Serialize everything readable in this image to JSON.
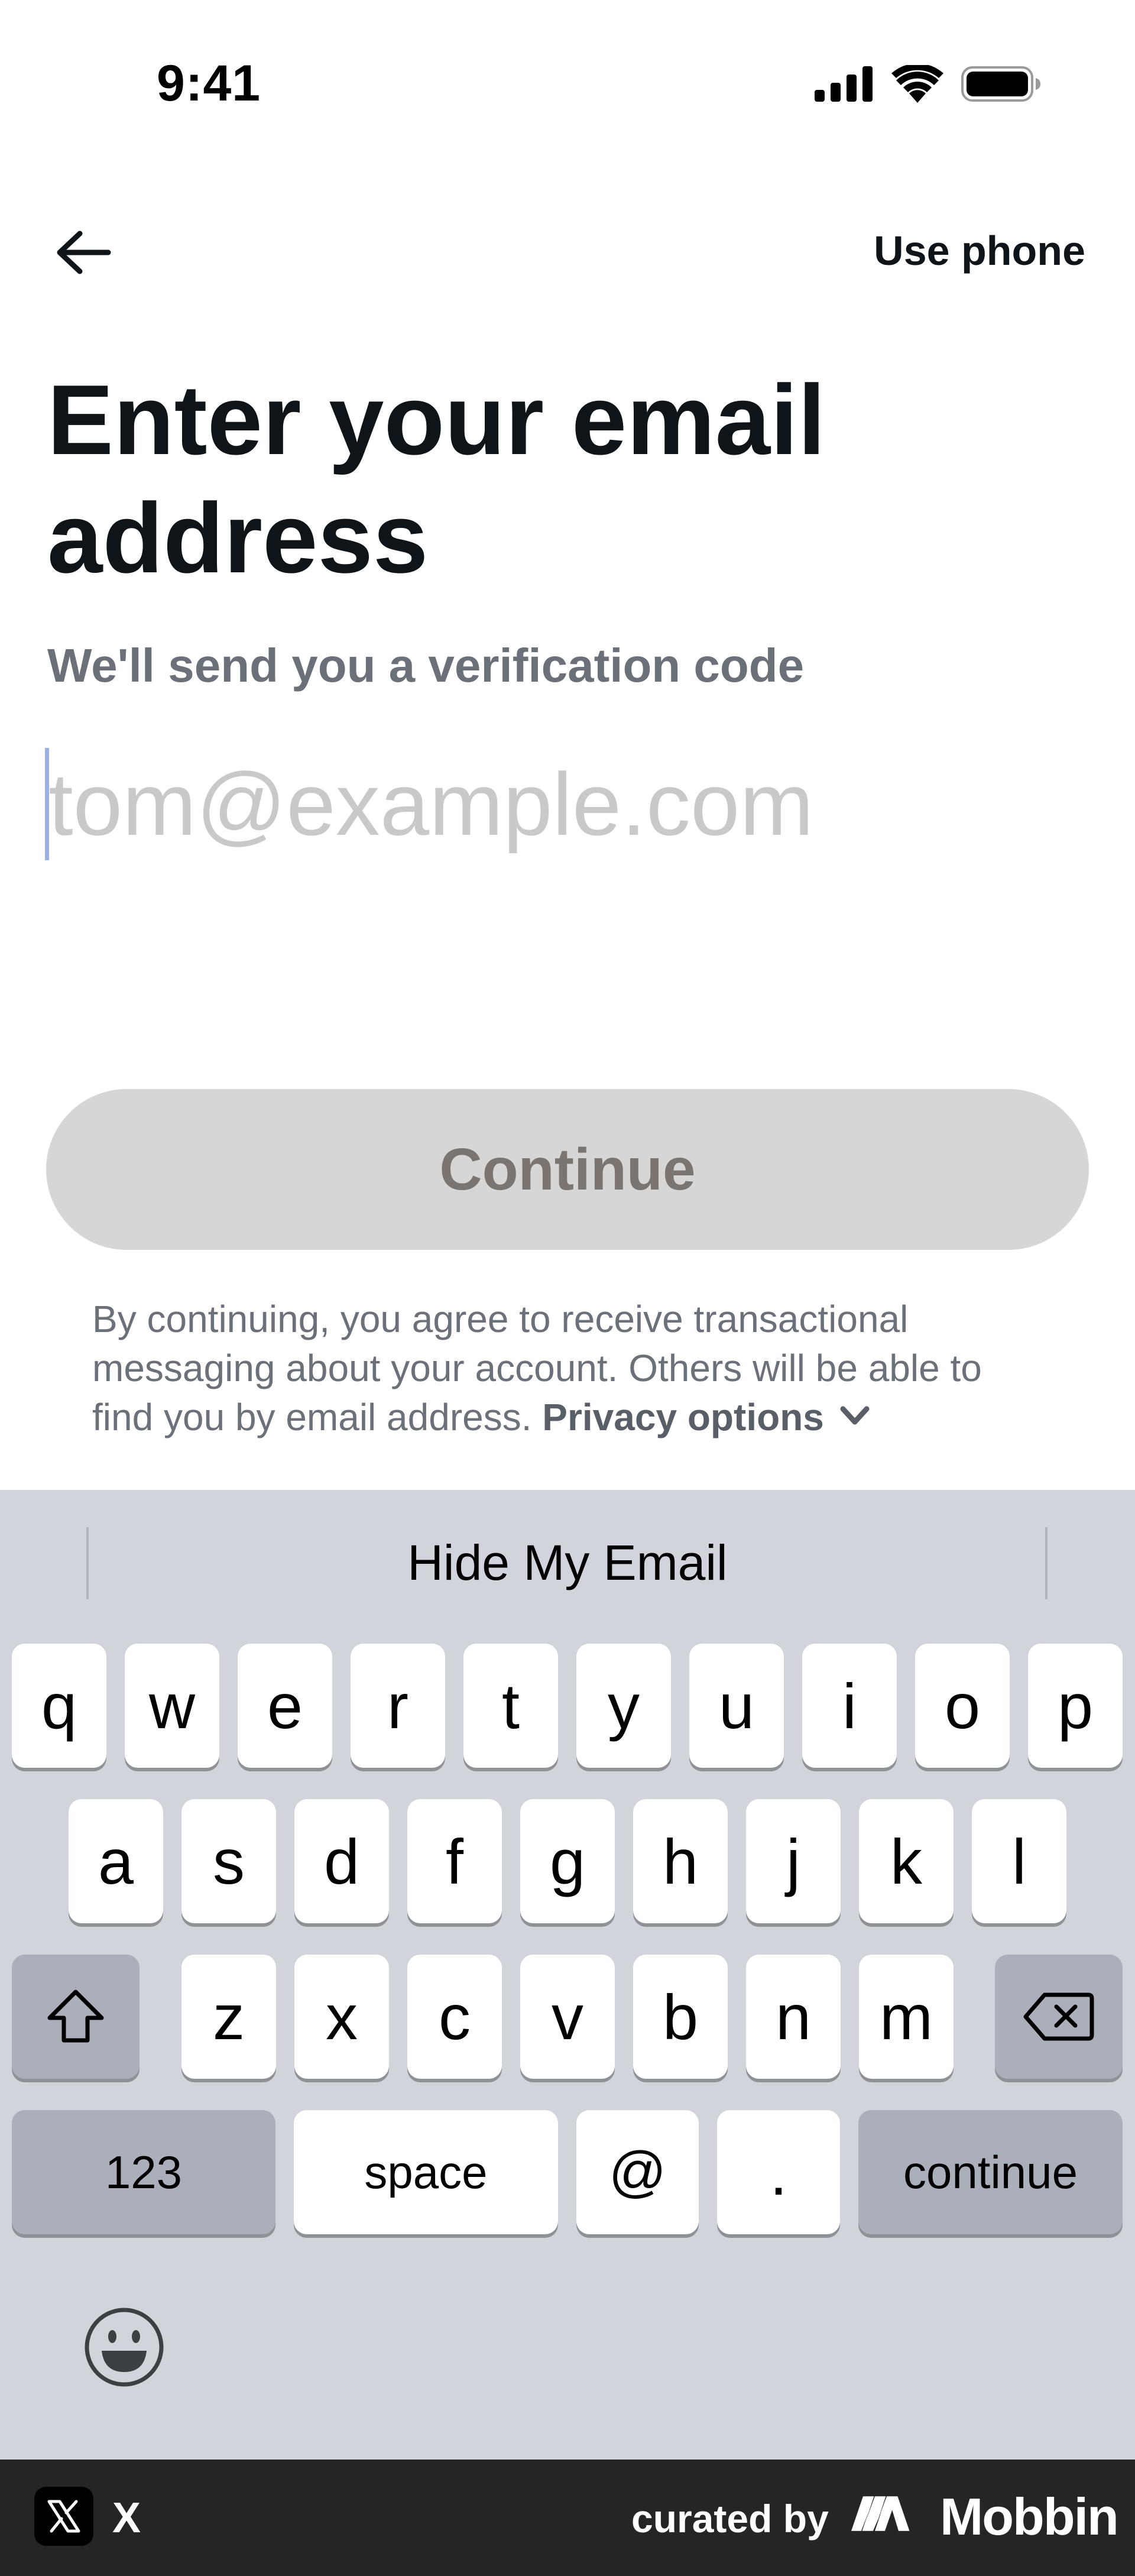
{
  "status_bar": {
    "time": "9:41",
    "signal_icon": "cellular-signal-icon",
    "wifi_icon": "wifi-icon",
    "battery_icon": "battery-icon"
  },
  "header": {
    "back_icon": "arrow-left-icon",
    "use_phone_label": "Use phone"
  },
  "main": {
    "title": "Enter your email address",
    "subtitle": "We'll send you a verification code",
    "email_placeholder": "tom@example.com",
    "email_value": "",
    "continue_label": "Continue",
    "disclaimer_text": "By continuing, you agree to receive transactional messaging about your account. Others will be able to find you by email address. ",
    "privacy_options_label": "Privacy options",
    "privacy_chevron_icon": "chevron-down-icon"
  },
  "keyboard": {
    "suggestion": "Hide My Email",
    "row1": [
      "q",
      "w",
      "e",
      "r",
      "t",
      "y",
      "u",
      "i",
      "o",
      "p"
    ],
    "row2": [
      "a",
      "s",
      "d",
      "f",
      "g",
      "h",
      "j",
      "k",
      "l"
    ],
    "row3": [
      "z",
      "x",
      "c",
      "v",
      "b",
      "n",
      "m"
    ],
    "shift_icon": "shift-icon",
    "backspace_icon": "backspace-icon",
    "numbers_label": "123",
    "space_label": "space",
    "at_label": "@",
    "dot_label": ".",
    "return_label": "continue",
    "emoji_icon": "emoji-icon"
  },
  "footer": {
    "app_logo_icon": "x-logo-icon",
    "app_name": "X",
    "curated_by": "curated by",
    "brand_logo_icon": "mobbin-logo-icon",
    "brand_name": "Mobbin"
  },
  "colors": {
    "text_primary": "#0f1419",
    "text_secondary": "#6b7079",
    "button_disabled_bg": "#d6d6d6",
    "button_disabled_text": "#7a7571",
    "keyboard_bg": "#d1d4db",
    "footer_bg": "#252525"
  }
}
